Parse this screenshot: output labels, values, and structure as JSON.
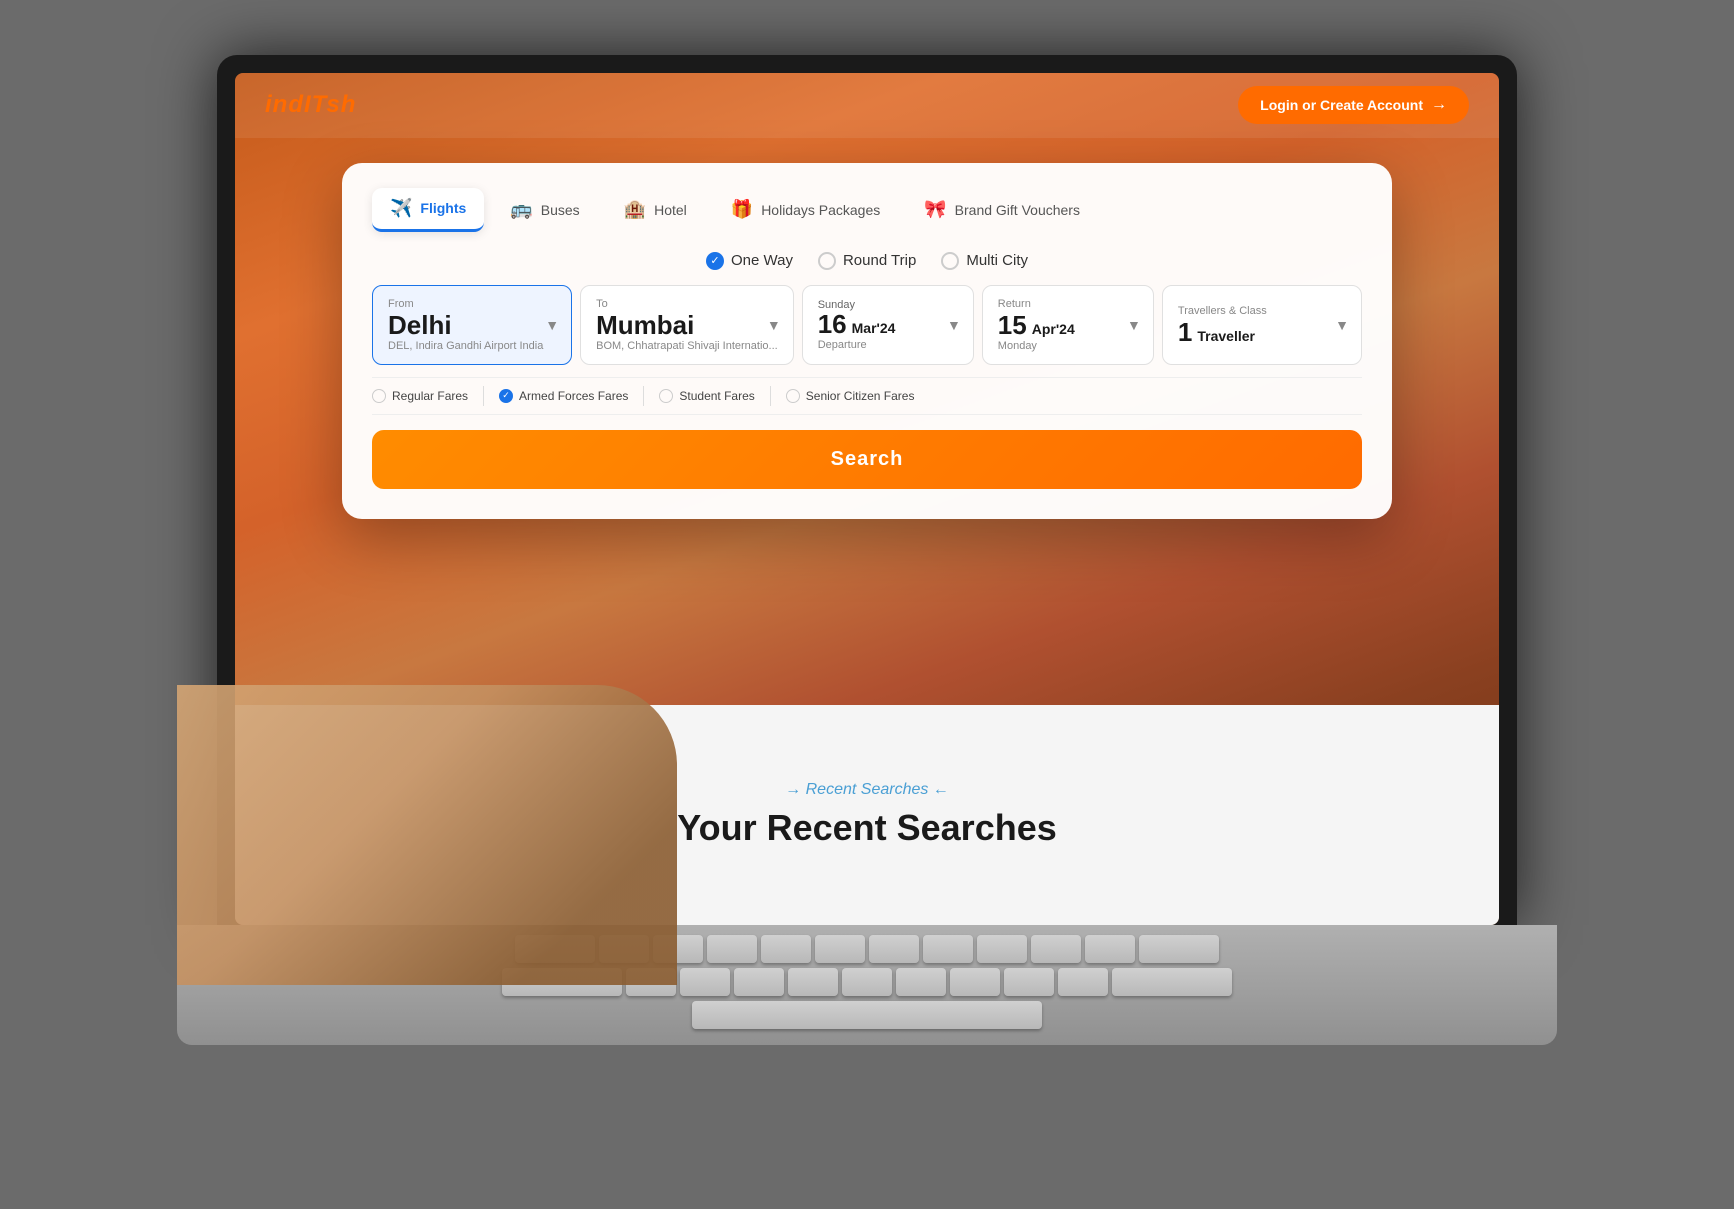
{
  "brand": {
    "name": "indITsh",
    "logo_color": "#ff6b00"
  },
  "navbar": {
    "login_button": "Login or Create Account"
  },
  "tabs": [
    {
      "id": "flights",
      "label": "Flights",
      "icon": "✈️",
      "active": true
    },
    {
      "id": "buses",
      "label": "Buses",
      "icon": "🚌",
      "active": false
    },
    {
      "id": "hotel",
      "label": "Hotel",
      "icon": "🏨",
      "active": false
    },
    {
      "id": "holidays",
      "label": "Holidays Packages",
      "icon": "🎁",
      "active": false
    },
    {
      "id": "vouchers",
      "label": "Brand Gift Vouchers",
      "icon": "🎀",
      "active": false
    }
  ],
  "trip_types": [
    {
      "id": "one_way",
      "label": "One Way",
      "selected": true
    },
    {
      "id": "round_trip",
      "label": "Round Trip",
      "selected": false
    },
    {
      "id": "multi_city",
      "label": "Multi City",
      "selected": false
    }
  ],
  "from_field": {
    "label": "From",
    "city": "Delhi",
    "airport": "DEL, Indira Gandhi Airport India"
  },
  "to_field": {
    "label": "To",
    "city": "Mumbai",
    "airport": "BOM, Chhatrapati Shivaji Internatio..."
  },
  "departure_field": {
    "label": "Departure",
    "day": "Sunday",
    "date": "16",
    "month": "Mar'24",
    "sub": "Departure"
  },
  "return_field": {
    "label": "Return",
    "day": "Monday",
    "date": "15",
    "month": "Apr'24",
    "sub": "Monday"
  },
  "traveller_field": {
    "label": "Travellers & Class",
    "count": "1",
    "unit": "Traveller"
  },
  "fare_options": [
    {
      "id": "regular",
      "label": "Regular Fares",
      "selected": false
    },
    {
      "id": "armed",
      "label": "Armed Forces Fares",
      "selected": true
    },
    {
      "id": "student",
      "label": "Student Fares",
      "selected": false
    },
    {
      "id": "senior",
      "label": "Senior Citizen Fares",
      "selected": false
    }
  ],
  "search_button": "Search",
  "recent_searches": {
    "tag": "Recent Searches",
    "title": "Your Recent Searches"
  }
}
